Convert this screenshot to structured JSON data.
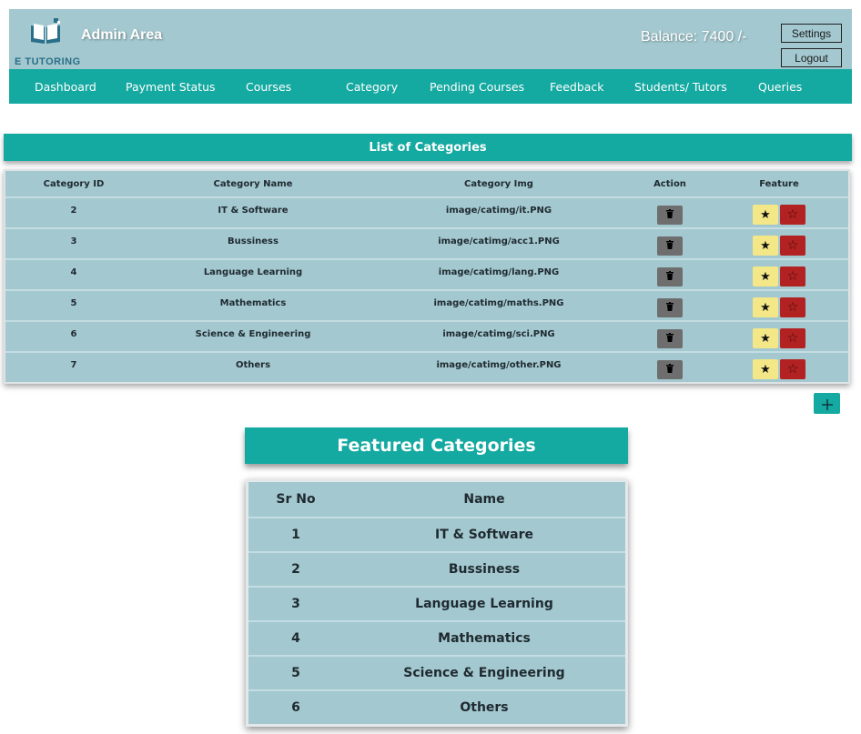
{
  "header": {
    "brand": "E TUTORING",
    "area_title": "Admin Area",
    "balance": "Balance: 7400 /-",
    "settings_label": "Settings",
    "logout_label": "Logout"
  },
  "nav": {
    "items": [
      {
        "label": "Dashboard"
      },
      {
        "label": "Payment Status"
      },
      {
        "label": "Courses"
      },
      {
        "label": "Category"
      },
      {
        "label": "Pending Courses"
      },
      {
        "label": "Feedback"
      },
      {
        "label": "Students/ Tutors"
      },
      {
        "label": "Queries"
      }
    ]
  },
  "categories": {
    "title": "List of Categories",
    "columns": {
      "id": "Category ID",
      "name": "Category Name",
      "img": "Category Img",
      "action": "Action",
      "feature": "Feature"
    },
    "rows": [
      {
        "id": "2",
        "name": "IT & Software",
        "img": "image/catimg/it.PNG"
      },
      {
        "id": "3",
        "name": "Bussiness",
        "img": "image/catimg/acc1.PNG"
      },
      {
        "id": "4",
        "name": "Language Learning",
        "img": "image/catimg/lang.PNG"
      },
      {
        "id": "5",
        "name": "Mathematics",
        "img": "image/catimg/maths.PNG"
      },
      {
        "id": "6",
        "name": "Science & Engineering",
        "img": "image/catimg/sci.PNG"
      },
      {
        "id": "7",
        "name": "Others",
        "img": "image/catimg/other.PNG"
      }
    ],
    "icons": {
      "delete": "trash-icon",
      "feature_on": "star-filled-icon",
      "feature_off": "star-outline-icon",
      "add": "plus-icon"
    }
  },
  "featured": {
    "title": "Featured Categories",
    "columns": {
      "sr": "Sr No",
      "name": "Name"
    },
    "rows": [
      {
        "sr": "1",
        "name": "IT & Software"
      },
      {
        "sr": "2",
        "name": "Bussiness"
      },
      {
        "sr": "3",
        "name": "Language Learning"
      },
      {
        "sr": "4",
        "name": "Mathematics"
      },
      {
        "sr": "5",
        "name": "Science & Engineering"
      },
      {
        "sr": "6",
        "name": "Others"
      }
    ]
  },
  "colors": {
    "header_bg": "#a3c8cf",
    "accent_teal": "#14a9a1",
    "delete_btn": "#6e6e6e",
    "feature_on": "#f4e787",
    "feature_off": "#b22222"
  }
}
